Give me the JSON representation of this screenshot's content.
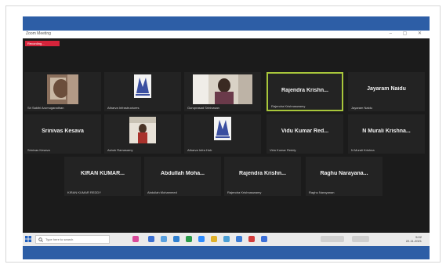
{
  "window": {
    "title": "Zoom Meeting",
    "controls": "– ▢ ✕"
  },
  "meeting": {
    "recording_label": "Recording...",
    "participants": [
      {
        "name": "",
        "sub": "Sri Sakthi Arumuganathan",
        "kind": "video"
      },
      {
        "name": "",
        "sub": "Atharva Infrastructures",
        "kind": "logo"
      },
      {
        "name": "",
        "sub": "Guruprasad Srinivasan",
        "kind": "video"
      },
      {
        "name": "Rajendra Krishn...",
        "sub": "Rajendra Krishnaswamy",
        "kind": "active"
      },
      {
        "name": "Jayaram Naidu",
        "sub": "Jayaram Naidu",
        "kind": "text"
      },
      {
        "name": "Srinivas Kesava",
        "sub": "Srinivas Kesava",
        "kind": "text"
      },
      {
        "name": "",
        "sub": "Ashok Ramasamy",
        "kind": "video"
      },
      {
        "name": "",
        "sub": "Atharva Infra Hub",
        "kind": "logo"
      },
      {
        "name": "Vidu Kumar Red...",
        "sub": "Vidu Kumar Reddy",
        "kind": "text"
      },
      {
        "name": "N Murali Krishna...",
        "sub": "N Murali Krishna",
        "kind": "text"
      },
      {
        "name": "KIRAN KUMAR...",
        "sub": "KIRAN KUMAR REDDY",
        "kind": "text"
      },
      {
        "name": "Abdullah Moha...",
        "sub": "Abdullah Mohammed",
        "kind": "text"
      },
      {
        "name": "Rajendra Krishn...",
        "sub": "Rajendra Krishnaswamy",
        "kind": "text"
      },
      {
        "name": "Raghu Narayana...",
        "sub": "Raghu Narayanan",
        "kind": "text"
      }
    ]
  },
  "taskbar": {
    "search_placeholder": "Type here to search",
    "time": "5:02",
    "date": "22-11-2021"
  },
  "colors": {
    "accent_border": "#a8c63b",
    "blue_band": "#2d5ea6",
    "recording": "#d6243b"
  }
}
